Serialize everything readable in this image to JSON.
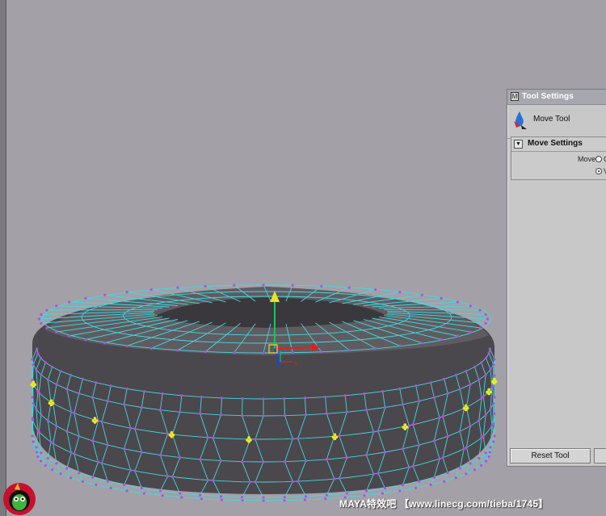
{
  "tool_settings": {
    "title": "Tool Settings",
    "tool_name": "Move Tool",
    "section_title": "Move Settings",
    "move_label": "Move",
    "move_options": [
      "O",
      "V"
    ],
    "selected_option_index": 1,
    "reset_button": "Reset Tool"
  },
  "watermark": "MAYA特效吧 【www.linecg.com/tieba/1745】",
  "colors": {
    "viewport_bg": "#a4a0a7",
    "mesh_dark": "#4a484c",
    "mesh_wire": "#45d8e0",
    "vertex": "#b050e0",
    "selected_vertex": "#e8f020",
    "manip_y": "#f0e020",
    "manip_x": "#e02020",
    "manip_z": "#2040f0"
  },
  "icons": [
    "maya-window-icon",
    "move-tool-icon",
    "collapse-arrow-icon",
    "mascot-logo-icon"
  ]
}
